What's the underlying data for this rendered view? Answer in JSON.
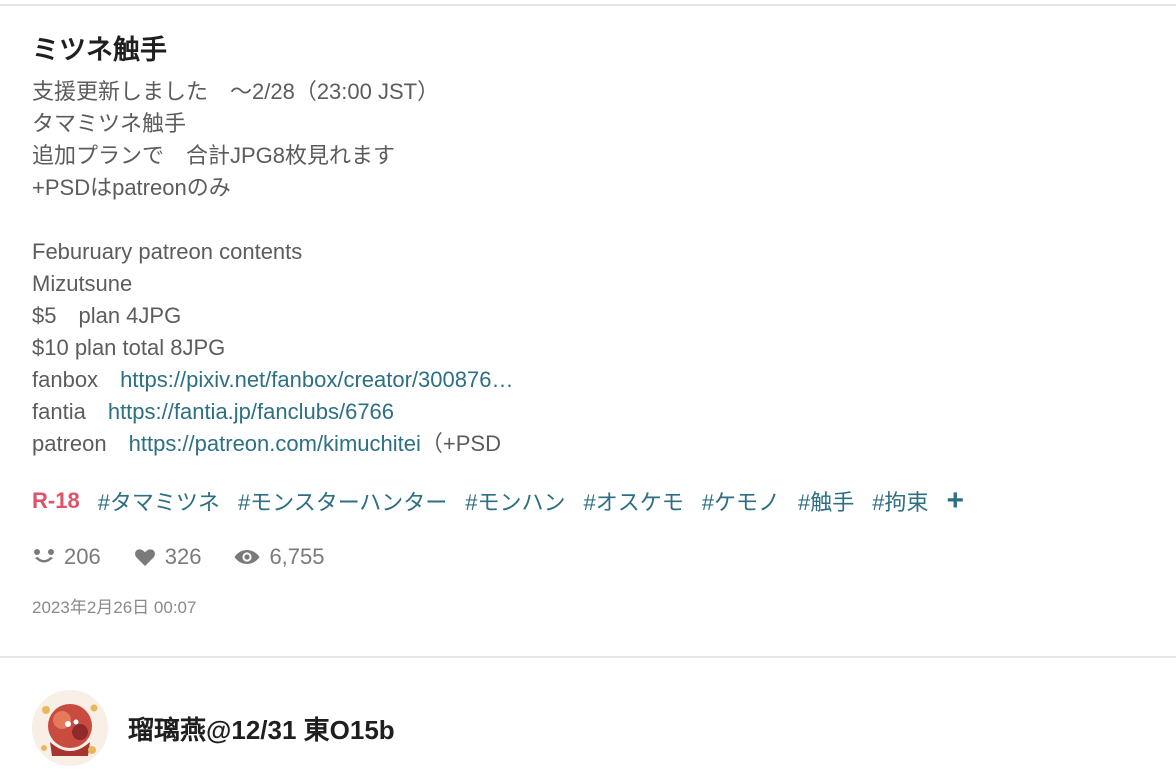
{
  "post": {
    "title": "ミツネ触手",
    "caption": [
      {
        "text": "支援更新しました　～2/28（23:00 JST）"
      },
      {
        "text": "タマミツネ触手"
      },
      {
        "text": "追加プランで　合計JPG8枚見れます"
      },
      {
        "text": "+PSDはpatreonのみ"
      },
      {
        "text": ""
      },
      {
        "text": "Feburuary patreon contents"
      },
      {
        "text": "Mizutsune"
      },
      {
        "text": "$5　plan 4JPG"
      },
      {
        "text": "$10 plan total 8JPG"
      },
      {
        "prefix": "fanbox　",
        "link": "https://pixiv.net/fanbox/creator/300876…",
        "suffix": ""
      },
      {
        "prefix": "fantia　",
        "link": "https://fantia.jp/fanclubs/6766",
        "suffix": ""
      },
      {
        "prefix": "patreon　",
        "link": "https://patreon.com/kimuchitei",
        "suffix": "（+PSD"
      }
    ],
    "rating": "R-18",
    "tags": [
      "#タマミツネ",
      "#モンスターハンター",
      "#モンハン",
      "#オスケモ",
      "#ケモノ",
      "#触手",
      "#拘束"
    ],
    "add_tag_glyph": "+",
    "stats": {
      "bookmarks": "206",
      "likes": "326",
      "views": "6,755"
    },
    "timestamp": "2023年2月26日 00:07"
  },
  "author": {
    "name": "瑠璃燕@12/31 東O15b"
  },
  "colors": {
    "link": "#2d6f83",
    "rating": "#e0526a",
    "text": "#5c5c5c",
    "meta": "#7a7a7a"
  },
  "icons": {
    "bookmarks": "smile-icon",
    "likes": "heart-icon",
    "views": "eye-icon",
    "add_tag": "plus-icon"
  }
}
